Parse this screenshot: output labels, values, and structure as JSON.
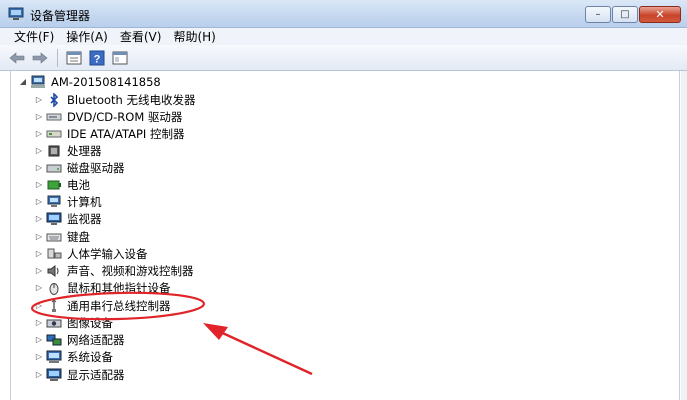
{
  "window": {
    "title": "设备管理器",
    "minimize_glyph": "–",
    "maximize_glyph": "□",
    "close_glyph": "✕"
  },
  "menu": [
    "文件(F)",
    "操作(A)",
    "查看(V)",
    "帮助(H)"
  ],
  "toolbar": {
    "buttons": [
      "back-arrow-icon",
      "forward-arrow-icon",
      "show-properties-icon",
      "help-icon",
      "console-tree-icon"
    ]
  },
  "tree": {
    "root": {
      "label": "AM-201508141858",
      "icon": "computer-icon"
    },
    "items": [
      {
        "label": "Bluetooth 无线电收发器",
        "icon": "bluetooth-icon"
      },
      {
        "label": "DVD/CD-ROM 驱动器",
        "icon": "dvd-drive-icon"
      },
      {
        "label": "IDE ATA/ATAPI 控制器",
        "icon": "ide-controller-icon"
      },
      {
        "label": "处理器",
        "icon": "processor-icon"
      },
      {
        "label": "磁盘驱动器",
        "icon": "disk-drive-icon"
      },
      {
        "label": "电池",
        "icon": "battery-icon"
      },
      {
        "label": "计算机",
        "icon": "computer-icon"
      },
      {
        "label": "监视器",
        "icon": "monitor-icon"
      },
      {
        "label": "键盘",
        "icon": "keyboard-icon"
      },
      {
        "label": "人体学输入设备",
        "icon": "hid-icon"
      },
      {
        "label": "声音、视频和游戏控制器",
        "icon": "sound-icon"
      },
      {
        "label": "鼠标和其他指针设备",
        "icon": "mouse-icon"
      },
      {
        "label": "通用串行总线控制器",
        "icon": "usb-icon"
      },
      {
        "label": "图像设备",
        "icon": "imaging-device-icon"
      },
      {
        "label": "网络适配器",
        "icon": "network-adapter-icon"
      },
      {
        "label": "系统设备",
        "icon": "system-device-icon"
      },
      {
        "label": "显示适配器",
        "icon": "display-adapter-icon"
      }
    ]
  },
  "annotation": {
    "highlighted_item": "通用串行总线控制器",
    "color": "#e0242a"
  }
}
